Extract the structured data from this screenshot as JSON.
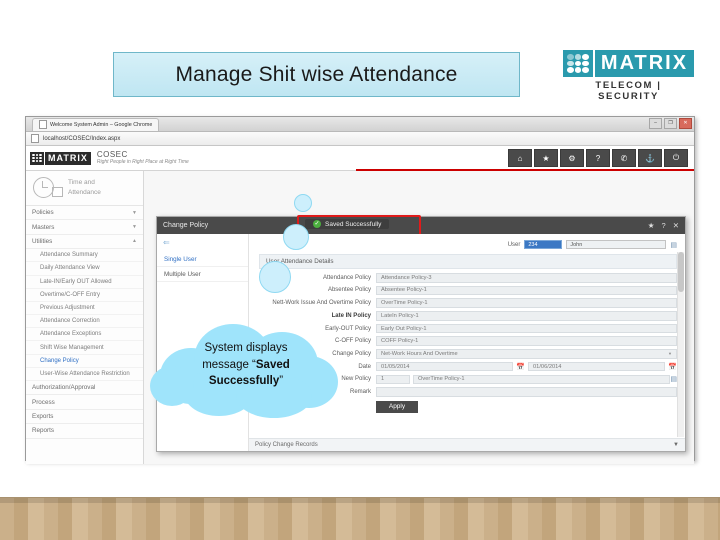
{
  "slide": {
    "title": "Manage Shit wise Attendance"
  },
  "logo": {
    "word": "MATRIX",
    "tagline": "TELECOM | SECURITY"
  },
  "browser": {
    "tab_title": "Welcome System  Admin – Google Chrome",
    "url": "localhost/COSEC/Index.aspx",
    "window_buttons": [
      "–",
      "❐",
      "✕"
    ]
  },
  "app_header": {
    "brand": "MATRIX",
    "product": "COSEC",
    "tagline": "Right People in Right Place at Right Time",
    "icons": [
      {
        "name": "home-icon",
        "glyph": "⌂"
      },
      {
        "name": "favorites-icon",
        "glyph": "★"
      },
      {
        "name": "settings-icon",
        "glyph": "⚙"
      },
      {
        "name": "help-icon",
        "glyph": "?"
      },
      {
        "name": "contact-icon",
        "glyph": "✆"
      },
      {
        "name": "sitemap-icon",
        "glyph": "⚓"
      },
      {
        "name": "power-icon",
        "glyph": "⏻"
      }
    ]
  },
  "sidebar": {
    "widget_line1": "Time and",
    "widget_line2": "Attendance",
    "groups": [
      {
        "label": "Policies",
        "caret": "▼"
      },
      {
        "label": "Masters",
        "caret": "▼"
      },
      {
        "label": "Utilities",
        "caret": "▲"
      }
    ],
    "utilities_items": [
      "Attendance Summary",
      "Daily Attendance View",
      "Late-IN/Early OUT Allowed",
      "Overtime/C-OFF Entry",
      "Previous Adjustment",
      "Attendance Correction",
      "Attendance Exceptions",
      "Shift Wise Management",
      "Change Policy",
      "User-Wise Attendance Restriction"
    ],
    "active_item": "Change Policy",
    "footer_groups": [
      "Authorization/Approval",
      "Process",
      "Exports",
      "Reports"
    ]
  },
  "dialog": {
    "title": "Change Policy",
    "toast": "Saved Successfully",
    "toast_icon": "✓",
    "actions": [
      {
        "name": "favorite-icon",
        "glyph": "★"
      },
      {
        "name": "help-icon",
        "glyph": "?"
      },
      {
        "name": "close-icon",
        "glyph": "✕"
      }
    ],
    "back_arrow": "⇐",
    "left_nav": [
      "Single User",
      "Multiple User"
    ],
    "left_nav_active": "Single User",
    "section_title": "User Attendance Details",
    "user_label": "User",
    "user_id": "234",
    "user_name": "John",
    "picker_icon": "▤",
    "fields": [
      {
        "label": "Attendance Policy",
        "value": "Attendance Policy-3",
        "bold": false
      },
      {
        "label": "Absentee Policy",
        "value": "Absentee Policy-1",
        "bold": false
      },
      {
        "label": "Nett-Work Issue And Overtime Policy",
        "value": "OverTime Policy-1",
        "bold": false
      },
      {
        "label": "Late IN Policy",
        "value": "LateIn Policy-1",
        "bold": true
      },
      {
        "label": "Early-OUT Policy",
        "value": "Early Out Policy-1",
        "bold": false
      },
      {
        "label": "C-OFF Policy",
        "value": "COFF Policy-1",
        "bold": false
      }
    ],
    "change_policy_label": "Change Policy",
    "change_policy_value": "Net-Work Hours And Overtime",
    "date_label": "Date",
    "date_from": "01/05/2014",
    "date_to": "01/06/2014",
    "calendar_icon": "Ὄ5",
    "new_policy_label": "New Policy",
    "new_policy_id": "1",
    "new_policy_value": "OverTime Policy-1",
    "remark_label": "Remark",
    "remark_value": "",
    "apply_label": "Apply",
    "records_label": "Policy Change Records",
    "records_caret": "▼"
  },
  "callout": {
    "line1": "System displays",
    "line2_prefix": "message “",
    "line2_bold": "Saved",
    "line3_bold": "Successfully",
    "line3_suffix": "”"
  }
}
